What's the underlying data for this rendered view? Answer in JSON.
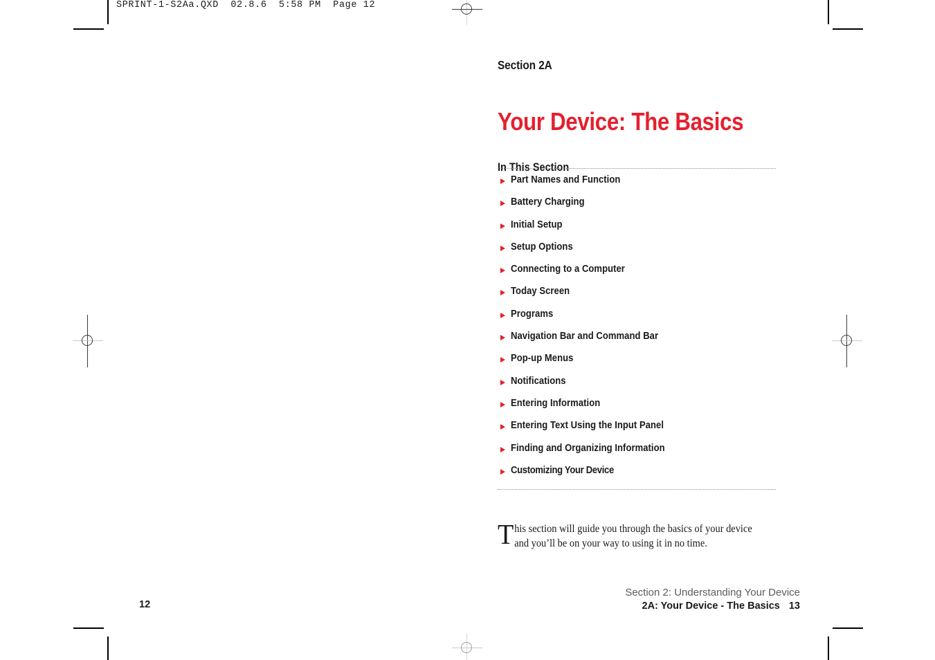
{
  "slug": {
    "text": "SPRINT-1-S2Aa.QXD  02.8.6  5:58 PM  Page 12"
  },
  "page": {
    "section_label": "Section 2A",
    "chapter_title": "Your Device: The Basics",
    "in_this_section_heading": "In This Section",
    "accent_color": "#e5202e",
    "text_color": "#1a1a1a",
    "footer_muted_color": "#5c5c5c"
  },
  "toc": {
    "items": [
      {
        "label": "Part Names and Function"
      },
      {
        "label": "Battery Charging"
      },
      {
        "label": "Initial Setup"
      },
      {
        "label": "Setup Options"
      },
      {
        "label": "Connecting to a Computer"
      },
      {
        "label": "Today Screen"
      },
      {
        "label": "Programs"
      },
      {
        "label": "Navigation Bar and Command Bar"
      },
      {
        "label": "Pop-up Menus"
      },
      {
        "label": "Notifications"
      },
      {
        "label": "Entering Information"
      },
      {
        "label": "Entering Text Using the Input Panel"
      },
      {
        "label": "Finding and Organizing Information"
      },
      {
        "label": "Customizing Your Device"
      }
    ]
  },
  "intro": {
    "dropcap": "T",
    "body": "his section will guide you through the basics of your device and you’ll be on your way to using it in no time."
  },
  "footer": {
    "folio_left": "12",
    "line1": "Section 2: Understanding Your Device",
    "line2": "2A: Your Device - The Basics",
    "folio_right": "13"
  }
}
